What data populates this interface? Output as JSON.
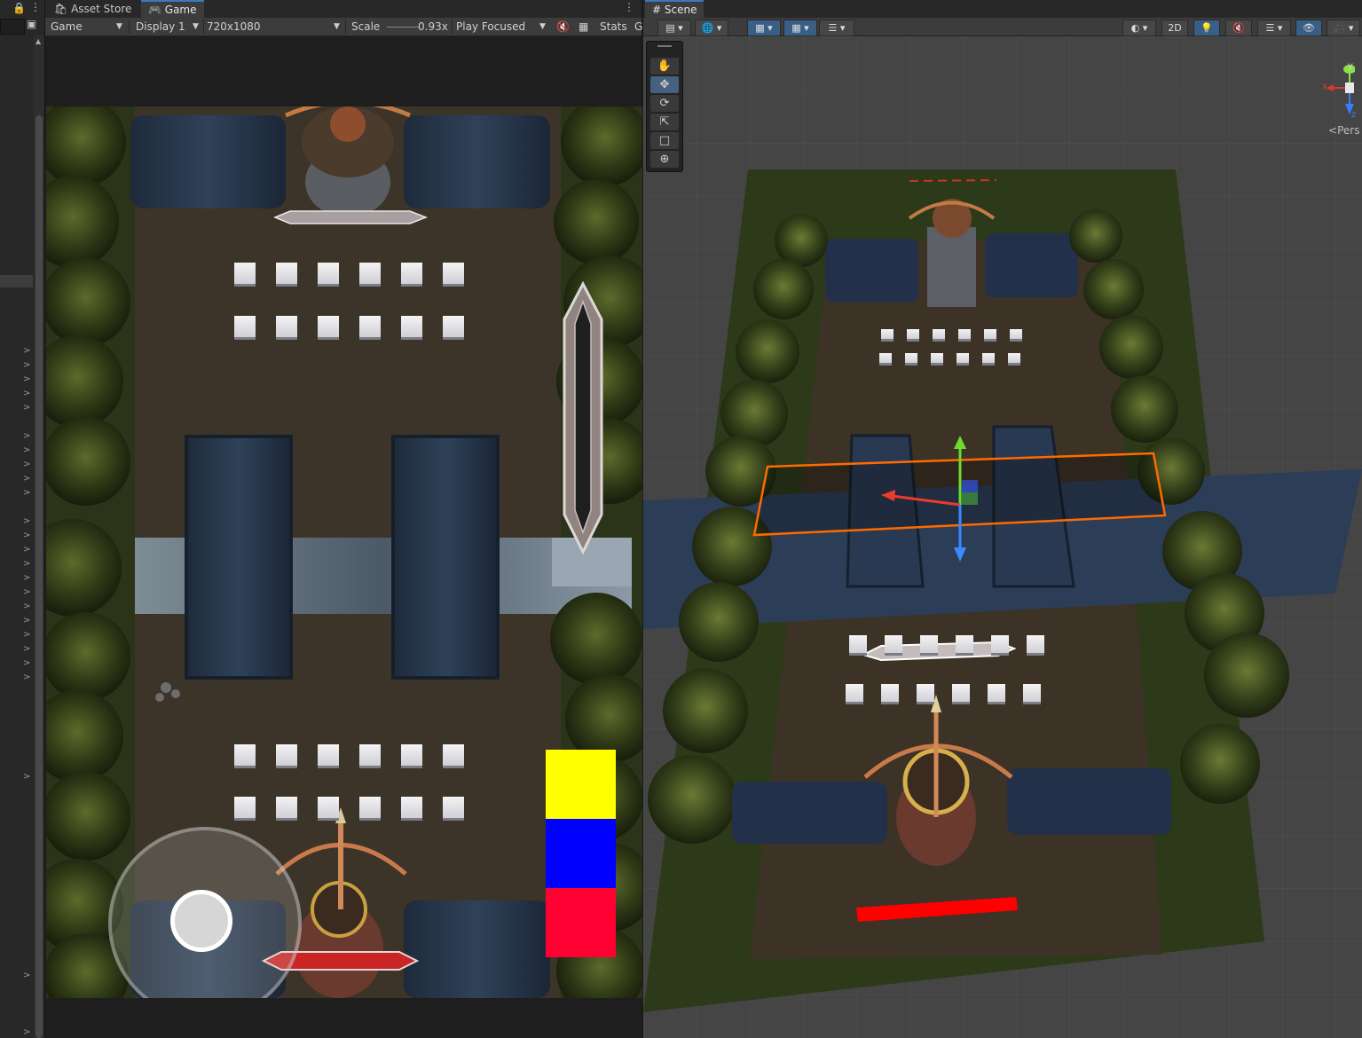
{
  "left_panel": {
    "lock_icon": "lock-icon",
    "menu_icon": "kebab-menu-icon",
    "layers_icon": "layers-icon",
    "row_chevron": ">"
  },
  "game_tabs": {
    "asset_store": "Asset Store",
    "game": "Game"
  },
  "game_toolbar": {
    "view_select": "Game",
    "display_select": "Display 1",
    "resolution_select": "720x1080",
    "scale_label": "Scale",
    "scale_value": "0.93x",
    "play_mode_select": "Play Focused",
    "stats_label": "Stats",
    "gizmos_label": "G"
  },
  "scene_tabs": {
    "scene": "Scene"
  },
  "scene_toolbar": {
    "mode_2d": "2D"
  },
  "scene_gizmo": {
    "x_label": "x",
    "y_label": "y",
    "z_label": "z",
    "projection": "Pers"
  },
  "game_view": {
    "health_colors": [
      "#ffff00",
      "#0000ff",
      "#ff0033"
    ],
    "tower_rows": 2,
    "tower_cols": 6
  },
  "tools": [
    "hand-tool",
    "move-tool",
    "rotate-tool",
    "scale-tool",
    "rect-tool",
    "transform-tool"
  ]
}
